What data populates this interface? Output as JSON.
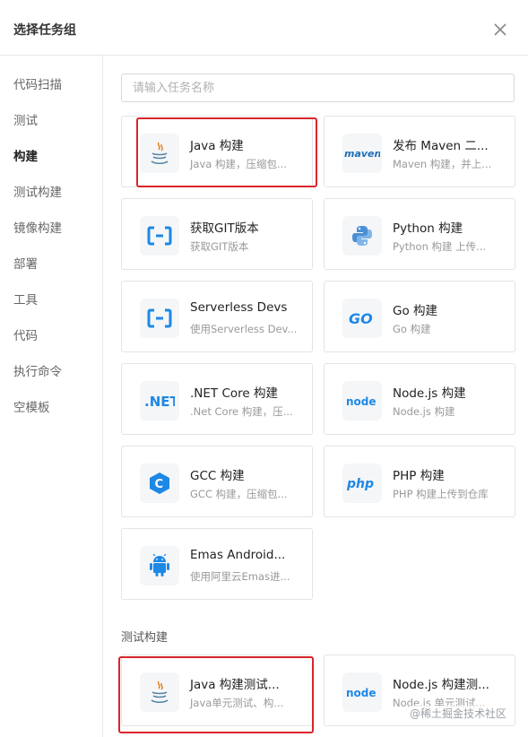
{
  "dialog": {
    "title": "选择任务组",
    "close_icon": "close-icon"
  },
  "sidebar": {
    "items": [
      {
        "label": "代码扫描"
      },
      {
        "label": "测试"
      },
      {
        "label": "构建",
        "active": true
      },
      {
        "label": "测试构建"
      },
      {
        "label": "镜像构建"
      },
      {
        "label": "部署"
      },
      {
        "label": "工具"
      },
      {
        "label": "代码"
      },
      {
        "label": "执行命令"
      },
      {
        "label": "空模板"
      }
    ]
  },
  "search": {
    "placeholder": "请输入任务名称",
    "value": ""
  },
  "build_cards": [
    {
      "name": "Java 构建",
      "desc": "Java 构建，压缩包...",
      "icon": "java-icon",
      "highlighted": true
    },
    {
      "name": "发布 Maven 二...",
      "desc": "Maven 构建，并上...",
      "icon": "maven-icon"
    },
    {
      "name": "获取GIT版本",
      "desc": "获取GIT版本",
      "icon": "git-version-icon"
    },
    {
      "name": "Python 构建",
      "desc": "Python 构建 上传...",
      "icon": "python-icon"
    },
    {
      "name": "Serverless Devs",
      "desc": "使用Serverless Dev...",
      "icon": "serverless-devs-icon"
    },
    {
      "name": "Go 构建",
      "desc": "Go 构建",
      "icon": "go-icon"
    },
    {
      "name": ".NET Core 构建",
      "desc": ".Net Core 构建，压...",
      "icon": "dotnet-icon"
    },
    {
      "name": "Node.js 构建",
      "desc": "Node.js 构建",
      "icon": "nodejs-icon"
    },
    {
      "name": "GCC 构建",
      "desc": "GCC 构建，压缩包...",
      "icon": "gcc-icon"
    },
    {
      "name": "PHP 构建",
      "desc": "PHP 构建上传到仓库",
      "icon": "php-icon"
    },
    {
      "name": "Emas Android...",
      "desc": "使用阿里云Emas进...",
      "icon": "android-icon"
    }
  ],
  "test_build_section": {
    "title": "测试构建",
    "cards": [
      {
        "name": "Java 构建测试...",
        "desc": "Java单元测试、构...",
        "icon": "java-icon",
        "highlighted": true
      },
      {
        "name": "Node.js 构建测...",
        "desc": "Node.js 单元测试...",
        "icon": "nodejs-icon"
      }
    ]
  },
  "watermark": "@稀土掘金技术社区",
  "colors": {
    "highlight": "#d8262b",
    "border": "#e4e4e4",
    "icon_blue": "#1e88e5",
    "muted_text": "#999999"
  }
}
